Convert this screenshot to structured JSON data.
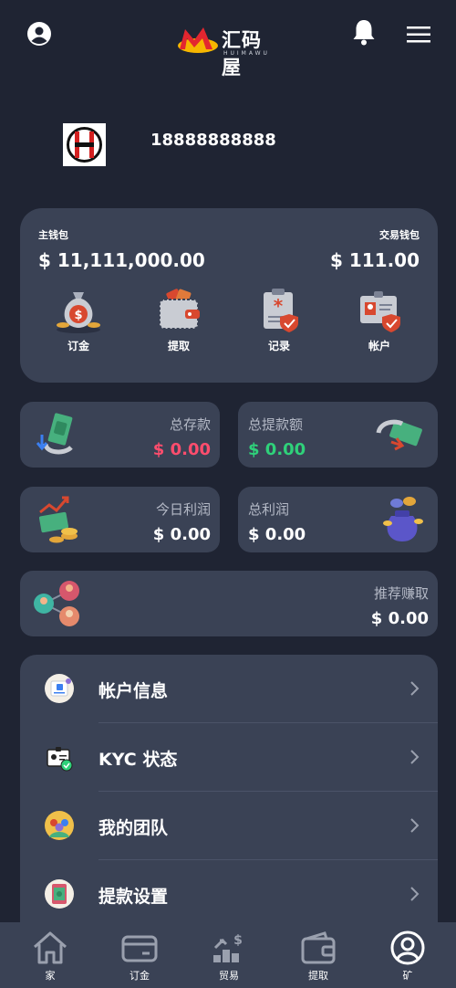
{
  "header": {
    "logo_text": "汇码屋",
    "logo_sub": "HUIMAWU",
    "icons": [
      "user-circle-icon",
      "bell-icon",
      "menu-icon"
    ]
  },
  "profile": {
    "phone": "18888888888"
  },
  "wallet": {
    "main_label": "主钱包",
    "main_value": "$ 11,111,000.00",
    "trade_label": "交易钱包",
    "trade_value": "$ 111.00",
    "actions": [
      {
        "label": "订金",
        "icon": "money-bag-icon"
      },
      {
        "label": "提取",
        "icon": "wallet-icon"
      },
      {
        "label": "记录",
        "icon": "clipboard-icon"
      },
      {
        "label": "帐户",
        "icon": "id-card-icon"
      }
    ]
  },
  "stats": {
    "total_deposit": {
      "label": "总存款",
      "value": "$ 0.00",
      "color": "#ff4d6d"
    },
    "total_withdraw": {
      "label": "总提款额",
      "value": "$ 0.00",
      "color": "#2fd17a"
    },
    "today_profit": {
      "label": "今日利润",
      "value": "$ 0.00"
    },
    "total_profit": {
      "label": "总利润",
      "value": "$ 0.00"
    },
    "referral": {
      "label": "推荐赚取",
      "value": "$ 0.00"
    }
  },
  "menu": [
    {
      "label": "帐户信息"
    },
    {
      "label": "KYC 状态"
    },
    {
      "label": "我的团队"
    },
    {
      "label": "提款设置"
    }
  ],
  "nav": [
    {
      "label": "家",
      "icon": "home-icon"
    },
    {
      "label": "订金",
      "icon": "card-icon"
    },
    {
      "label": "贸易",
      "icon": "trade-icon"
    },
    {
      "label": "提取",
      "icon": "wallet-icon"
    },
    {
      "label": "矿",
      "icon": "user-circle-icon"
    }
  ],
  "colors": {
    "background": "#1f2433",
    "card": "#3a4255",
    "accent_red": "#ff4d6d",
    "accent_green": "#2fd17a"
  }
}
